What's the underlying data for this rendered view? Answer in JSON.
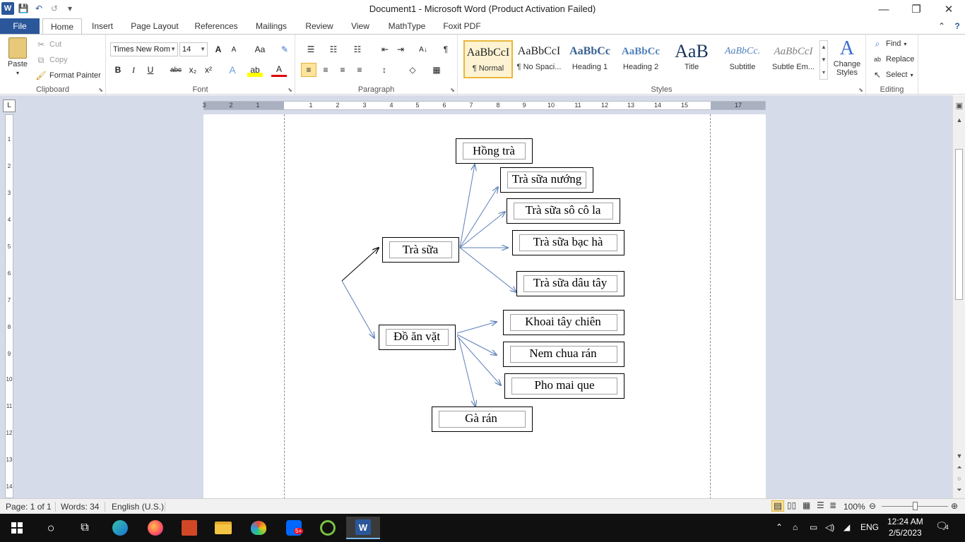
{
  "window": {
    "title": "Document1  -  Microsoft Word (Product Activation Failed)",
    "minimize_glyph": "—",
    "restore_glyph": "❐",
    "close_glyph": "✕"
  },
  "qat": {
    "logo": "W",
    "save": "💾",
    "undo": "↶",
    "redo": "↺",
    "customize": "▾"
  },
  "tabs": {
    "file": "File",
    "items": [
      "Home",
      "Insert",
      "Page Layout",
      "References",
      "Mailings",
      "Review",
      "View",
      "MathType",
      "Foxit PDF"
    ],
    "collapse_glyph": "⌃",
    "help_glyph": "?"
  },
  "clipboard": {
    "paste": "Paste",
    "cut": "Cut",
    "copy": "Copy",
    "format_painter": "Format Painter",
    "label": "Clipboard"
  },
  "font": {
    "name": "Times New Rom",
    "size": "14",
    "grow": "A",
    "shrink": "A",
    "change_case": "Aa",
    "clear": "✎",
    "bold": "B",
    "italic": "I",
    "underline": "U",
    "strike": "abc",
    "subscript": "x₂",
    "superscript": "x²",
    "effects": "A",
    "highlight": "ab",
    "font_color": "A",
    "label": "Font"
  },
  "paragraph": {
    "bullets": "☰",
    "numbering": "☷",
    "multilevel": "☷",
    "dec_indent": "⇤",
    "inc_indent": "⇥",
    "sort": "A↓",
    "pilcrow": "¶",
    "align_left": "≡",
    "center": "≡",
    "align_right": "≡",
    "justify": "≡",
    "line_spacing": "↕",
    "shading": "◇",
    "borders": "▦",
    "label": "Paragraph"
  },
  "styles": {
    "items": [
      {
        "preview": "AaBbCcI",
        "name": "¶ Normal"
      },
      {
        "preview": "AaBbCcI",
        "name": "¶ No Spaci..."
      },
      {
        "preview": "AaBbCc",
        "name": "Heading 1"
      },
      {
        "preview": "AaBbCc",
        "name": "Heading 2"
      },
      {
        "preview": "AaB",
        "name": "Title"
      },
      {
        "preview": "AaBbCc.",
        "name": "Subtitle"
      },
      {
        "preview": "AaBbCcI",
        "name": "Subtle Em..."
      }
    ],
    "change_styles": "Change Styles",
    "label": "Styles"
  },
  "editing": {
    "find": "Find",
    "replace": "Replace",
    "select": "Select",
    "label": "Editing"
  },
  "ruler": {
    "tab_selector": "L",
    "h_numbers": [
      "3",
      "2",
      "1",
      "1",
      "2",
      "3",
      "4",
      "5",
      "6",
      "7",
      "8",
      "9",
      "10",
      "11",
      "12",
      "13",
      "14",
      "15",
      "17"
    ],
    "v_numbers": [
      "1",
      "2",
      "3",
      "4",
      "5",
      "6",
      "7",
      "8",
      "9",
      "10",
      "11",
      "12",
      "13",
      "14"
    ]
  },
  "diagram": {
    "nodes": {
      "hong_tra": "Hồng trà",
      "tra_sua_nuong": "Trà sữa nướng",
      "tra_sua_socola": "Trà sữa sô cô la",
      "tra_sua": "Trà sữa",
      "tra_sua_bac_ha": "Trà sữa bạc hà",
      "tra_sua_dau_tay": "Trà sữa dâu tây",
      "khoai_tay_chien": "Khoai tây chiên",
      "do_an_vat": "Đồ ăn vặt",
      "nem_chua_ran": "Nem chua rán",
      "pho_mai_que": "Pho mai que",
      "ga_ran": "Gà rán"
    },
    "arrow_color": "#5b7fb8"
  },
  "status": {
    "page": "Page: 1 of 1",
    "words": "Words: 34",
    "language": "English (U.S.)",
    "zoom": "100%"
  },
  "taskbar": {
    "clock_time": "12:24 AM",
    "clock_date": "2/5/2023",
    "lang": "ENG",
    "notif_count": "4",
    "zalo_badge": "5+"
  }
}
